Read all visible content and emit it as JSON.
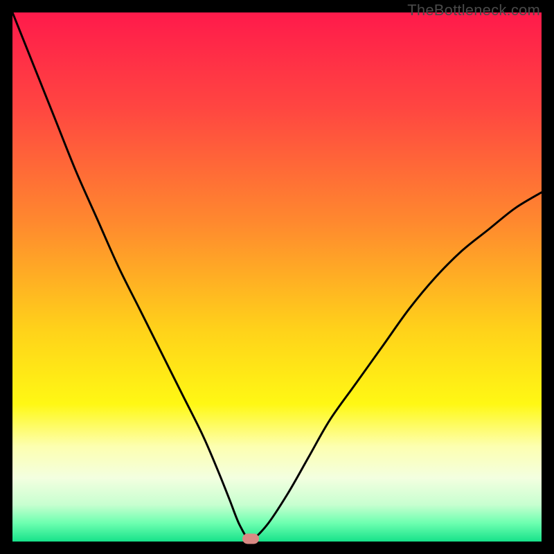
{
  "watermark": "TheBottleneck.com",
  "colors": {
    "bg": "#000000",
    "marker": "#d98a84",
    "curve": "#000000",
    "gradient_stops": [
      {
        "offset": 0.0,
        "color": "#ff1a4b"
      },
      {
        "offset": 0.18,
        "color": "#ff4641"
      },
      {
        "offset": 0.4,
        "color": "#ff8a2e"
      },
      {
        "offset": 0.6,
        "color": "#ffd21a"
      },
      {
        "offset": 0.74,
        "color": "#fff814"
      },
      {
        "offset": 0.82,
        "color": "#fdffb0"
      },
      {
        "offset": 0.88,
        "color": "#f3ffe0"
      },
      {
        "offset": 0.93,
        "color": "#c8ffd0"
      },
      {
        "offset": 0.965,
        "color": "#6dffb0"
      },
      {
        "offset": 1.0,
        "color": "#17e28a"
      }
    ]
  },
  "chart_data": {
    "type": "line",
    "title": "",
    "xlabel": "",
    "ylabel": "",
    "xlim": [
      0,
      100
    ],
    "ylim": [
      0,
      100
    ],
    "x_values": [
      0,
      4,
      8,
      12,
      16,
      20,
      24,
      28,
      32,
      36,
      39,
      41,
      43,
      45,
      48,
      52,
      56,
      60,
      65,
      70,
      75,
      80,
      85,
      90,
      95,
      100
    ],
    "y_values": [
      100,
      90,
      80,
      70,
      61,
      52,
      44,
      36,
      28,
      20,
      13,
      8,
      3,
      0.5,
      3,
      9,
      16,
      23,
      30,
      37,
      44,
      50,
      55,
      59,
      63,
      66
    ],
    "marker": {
      "x": 45,
      "y": 0.5
    },
    "note": "y=0 is at the bottom of the plot area, y=100 at the top; values read approximately from the image"
  }
}
